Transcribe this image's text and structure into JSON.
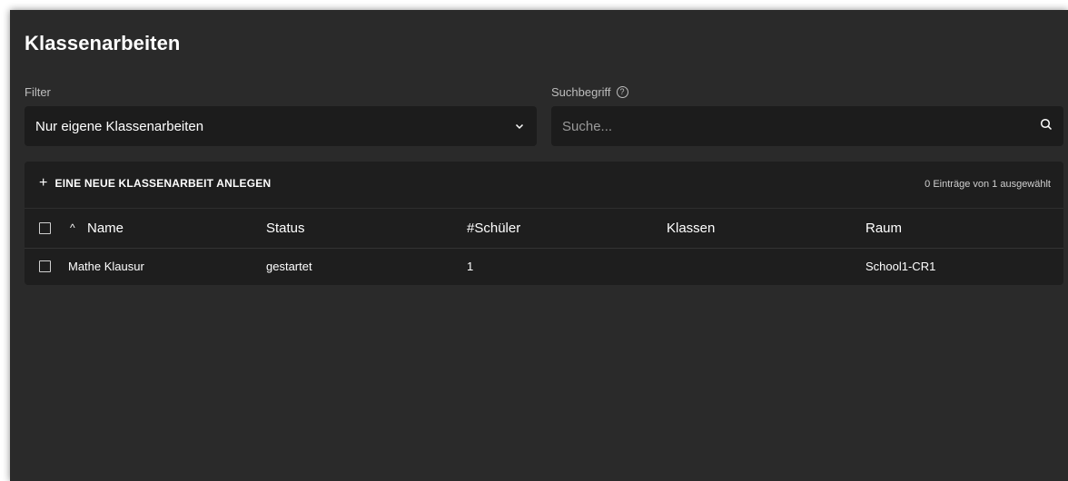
{
  "page": {
    "title": "Klassenarbeiten"
  },
  "filter": {
    "label": "Filter",
    "selected": "Nur eigene Klassenarbeiten"
  },
  "search": {
    "label": "Suchbegriff",
    "placeholder": "Suche...",
    "value": ""
  },
  "toolbar": {
    "add_label": "EINE NEUE KLASSENARBEIT ANLEGEN",
    "selection_text": "0 Einträge von 1 ausgewählt"
  },
  "table": {
    "columns": [
      "Name",
      "Status",
      "#Schüler",
      "Klassen",
      "Raum"
    ],
    "rows": [
      [
        "Mathe Klausur",
        "gestartet",
        "1",
        "",
        "School1-CR1"
      ]
    ]
  },
  "icons": {
    "help": "help-circle-icon",
    "chevron": "chevron-down-icon",
    "search": "search-icon",
    "add": "plus-icon",
    "sort": "sort-ascending-icon"
  },
  "colors": {
    "background": "#2a2a2a",
    "surface": "#1e1e1e",
    "input": "#1c1c1c",
    "text": "#ffffff",
    "muted": "#bdbdbd"
  }
}
